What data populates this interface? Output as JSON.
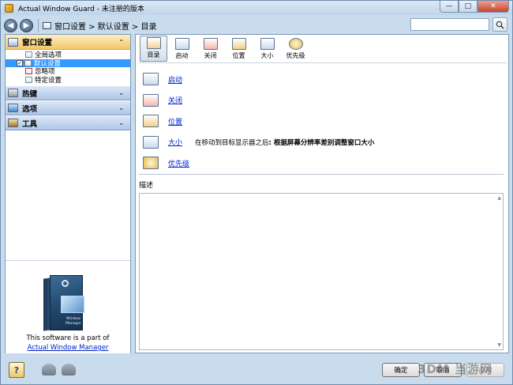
{
  "window": {
    "title": "Actual Window Guard - 未注册的版本"
  },
  "titlebar_buttons": {
    "minimize": "—",
    "maximize": "□",
    "close": "✕"
  },
  "nav": {
    "back": "◀",
    "forward": "▶",
    "breadcrumb": "窗口设置 > 默认设置 > 目录",
    "search_placeholder": ""
  },
  "sidebar": {
    "sections": [
      {
        "label": "窗口设置",
        "chevron": "⌃",
        "colors": "#f2c76a"
      },
      {
        "label": "热键",
        "chevron": "⌄"
      },
      {
        "label": "选项",
        "chevron": "⌄"
      },
      {
        "label": "工具",
        "chevron": "⌄"
      }
    ],
    "tree": [
      {
        "label": "全局选项",
        "checkbox": false
      },
      {
        "label": "默认设置",
        "checkbox": true,
        "checked": "✓"
      },
      {
        "label": "忽略项",
        "checkbox": false
      },
      {
        "label": "特定设置",
        "checkbox": false
      }
    ],
    "promo": {
      "box_title": "Window Manager",
      "line1": "This software is a part of",
      "link": "Actual Window Manager"
    }
  },
  "toolbar": {
    "buttons": [
      {
        "label": "目录"
      },
      {
        "label": "启动"
      },
      {
        "label": "关闭"
      },
      {
        "label": "位置"
      },
      {
        "label": "大小"
      },
      {
        "label": "优先级"
      }
    ]
  },
  "links": [
    {
      "label": "启动"
    },
    {
      "label": "关闭"
    },
    {
      "label": "位置"
    },
    {
      "label": "大小",
      "desc_prefix": "在移动到目标显示器之后",
      "desc_bold": ": 根据屏幕分辨率差别调整窗口大小"
    },
    {
      "label": "优先级"
    }
  ],
  "description": {
    "label": "描述"
  },
  "buttons": {
    "ok": "确定",
    "cancel": "取消",
    "apply": "应用"
  },
  "watermark": "3DM 当游网"
}
